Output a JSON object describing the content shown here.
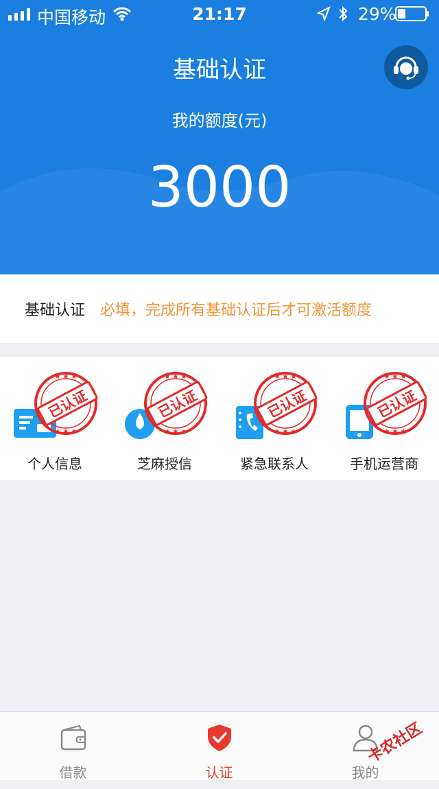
{
  "status_bar": {
    "carrier": "中国移动",
    "time": "21:17",
    "battery": "29%",
    "battery_level": 0.29
  },
  "header": {
    "title": "基础认证",
    "quota_label": "我的额度(元)",
    "quota_amount": "3000",
    "service_icon": "customer-service-icon"
  },
  "notice": {
    "title": "基础认证",
    "text": "必填，完成所有基础认证后才可激活额度"
  },
  "stamp_text": "已认证",
  "items": [
    {
      "label": "个人信息",
      "icon": "id-card-icon"
    },
    {
      "label": "芝麻授信",
      "icon": "sesame-credit-icon"
    },
    {
      "label": "紧急联系人",
      "icon": "contact-book-icon"
    },
    {
      "label": "手机运营商",
      "icon": "mobile-phone-icon"
    }
  ],
  "tabs": [
    {
      "label": "借款",
      "icon": "wallet-icon",
      "active": false
    },
    {
      "label": "认证",
      "icon": "shield-check-icon",
      "active": true
    },
    {
      "label": "我的",
      "icon": "user-icon",
      "active": false
    }
  ],
  "colors": {
    "primary": "#1a7fe0",
    "notice": "#f0963a",
    "active_tab": "#e8392f",
    "stamp": "#e32a2a",
    "icon_blue": "#1e9ff0"
  },
  "watermark": "卡农社区"
}
